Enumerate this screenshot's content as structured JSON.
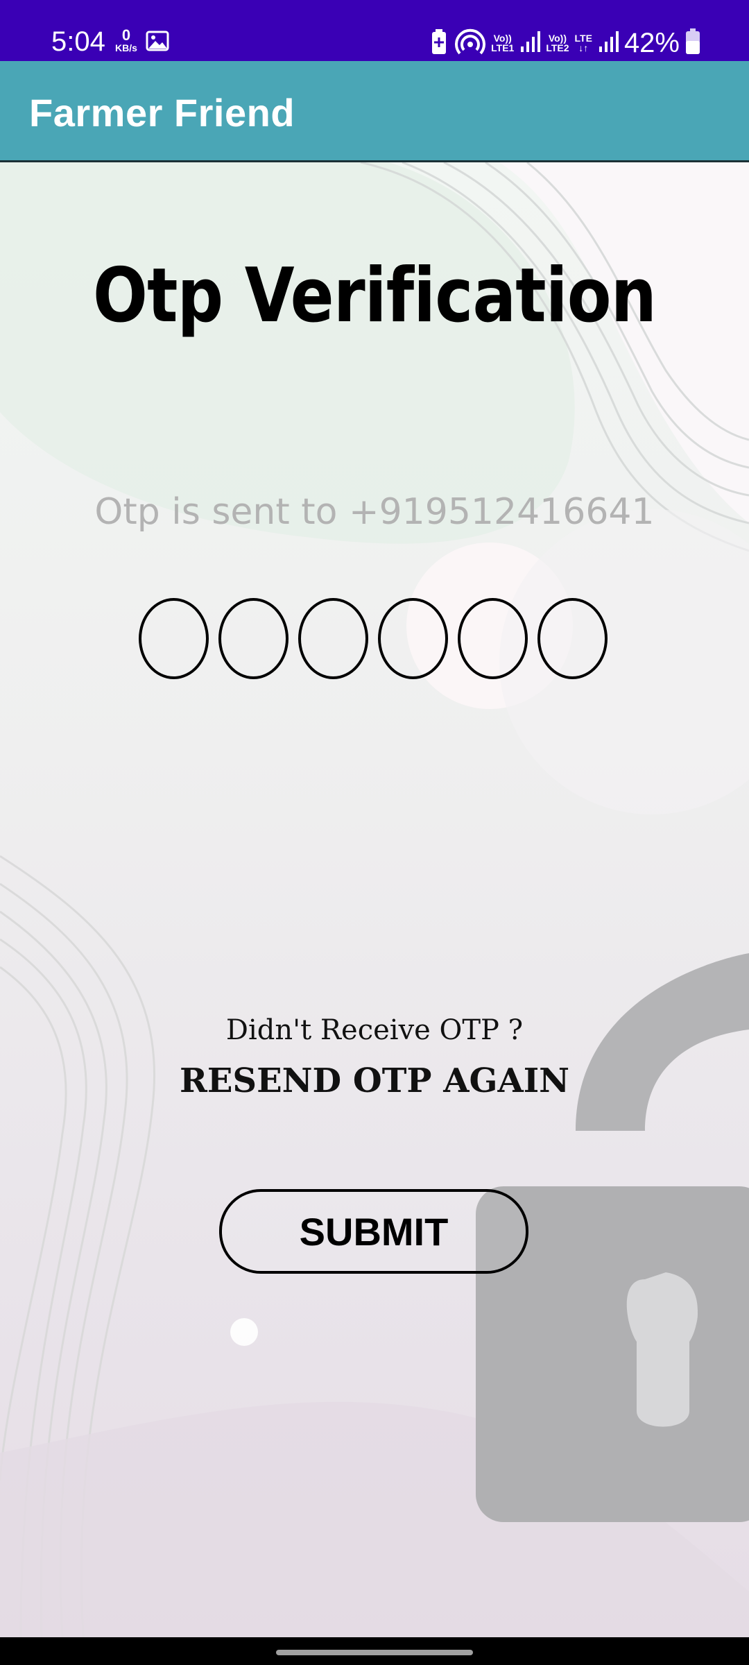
{
  "status_bar": {
    "time": "5:04",
    "net_speed_value": "0",
    "net_speed_unit": "KB/s",
    "sim1_label_top": "Vo))",
    "sim1_label_bottom": "LTE1",
    "sim2_label_top": "Vo))",
    "sim2_label_bottom": "LTE2",
    "data_label": "LTE",
    "battery_percent": "42%",
    "background_color": "#3a00b5"
  },
  "app_bar": {
    "title": "Farmer Friend",
    "background_color": "#4aa6b6"
  },
  "otp_screen": {
    "heading": "Otp Verification",
    "sent_message": "Otp is sent to +919512416641",
    "digit_fields": [
      "",
      "",
      "",
      "",
      "",
      ""
    ],
    "didnt_receive_text": "Didn't Receive OTP ?",
    "resend_label": "RESEND OTP AGAIN",
    "submit_label": "SUBMIT"
  }
}
